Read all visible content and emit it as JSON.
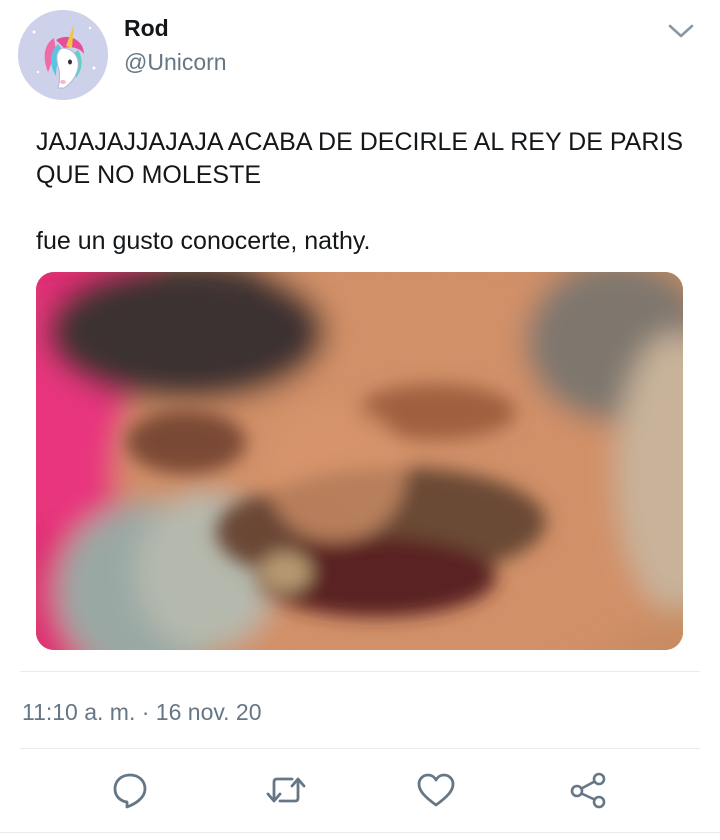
{
  "author": {
    "display_name": "Rod",
    "handle": "@Unicorn",
    "avatar_icon": "unicorn-avatar"
  },
  "tweet": {
    "lines": [
      "JAJAJAJJAJAJA ACABA DE DECIRLE AL REY DE PARIS QUE NO MOLESTE",
      "fue un gusto conocerte, nathy."
    ],
    "media_description": "blurry close-up photo of a laughing man with a mustache"
  },
  "meta": {
    "timestamp": "11:10 a. m. · 16 nov. 20"
  },
  "actions": [
    {
      "name": "reply",
      "icon": "speech-bubble-icon"
    },
    {
      "name": "retweet",
      "icon": "retweet-icon"
    },
    {
      "name": "like",
      "icon": "heart-icon"
    },
    {
      "name": "share",
      "icon": "share-icon"
    }
  ],
  "colors": {
    "text": "#14171a",
    "secondary": "#657786",
    "divider": "#e6ecf0",
    "icon": "#657786"
  }
}
